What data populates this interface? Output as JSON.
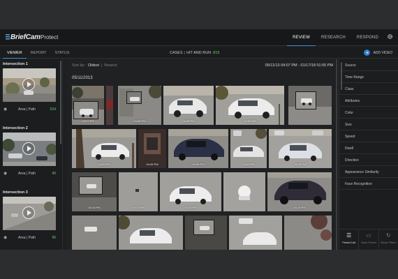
{
  "app": {
    "brand": "BriefCam",
    "product": "Protect"
  },
  "topnav": [
    {
      "label": "REVIEW",
      "active": true
    },
    {
      "label": "RESEARCH",
      "active": false
    },
    {
      "label": "RESPOND",
      "active": false
    }
  ],
  "subtabs": [
    {
      "label": "VIEWER",
      "active": true
    },
    {
      "label": "REPORT",
      "active": false
    },
    {
      "label": "STATUS",
      "active": false
    }
  ],
  "breadcrumb": {
    "root": "CASES",
    "separator": "|",
    "case": "HIT AND RUN",
    "count": "819"
  },
  "add_video": "ADD VIDEO",
  "cameras": [
    {
      "title": "Intersection 1",
      "area_path": "Area | Path",
      "count": "534"
    },
    {
      "title": "Intersection 2",
      "area_path": "Area | Path",
      "count": "40"
    },
    {
      "title": "Intersection 3",
      "area_path": "Area | Path",
      "count": "96"
    }
  ],
  "sort": {
    "label": "Sort by:",
    "oldest": "Oldest",
    "newest": "Newest",
    "separator": "|"
  },
  "date_range": "05/11/13 04:07 PM - 01/17/18 01:55 PM",
  "day_header": "05/11/2013",
  "timestamps": {
    "r1": [
      "04:07 PM",
      "04:08 PM",
      "04:08 PM",
      "04:08 PM"
    ],
    "r2": [
      "04:09 PM",
      "04:09 PM",
      "04:09 PM",
      "04:09 PM",
      "04:10 PM"
    ],
    "r3": [
      "04:10 PM",
      "04:10 PM",
      "04:10 PM",
      "04:10 PM"
    ]
  },
  "filters": [
    "Source",
    "Time Range",
    "Class",
    "Attributes",
    "Color",
    "Size",
    "Speed",
    "Dwell",
    "Direction",
    "Appearance Similarity",
    "Face Recognition"
  ],
  "bottom_actions": [
    {
      "label": "Preset List",
      "icon": "list-icon",
      "active": true
    },
    {
      "label": "Save Preset",
      "icon": "save-icon",
      "active": false
    },
    {
      "label": "Reset Filters",
      "icon": "reset-icon",
      "active": false
    }
  ],
  "colors": {
    "accent": "#3d8fd6",
    "count_green": "#5fd35f",
    "background": "#1e1f21"
  }
}
